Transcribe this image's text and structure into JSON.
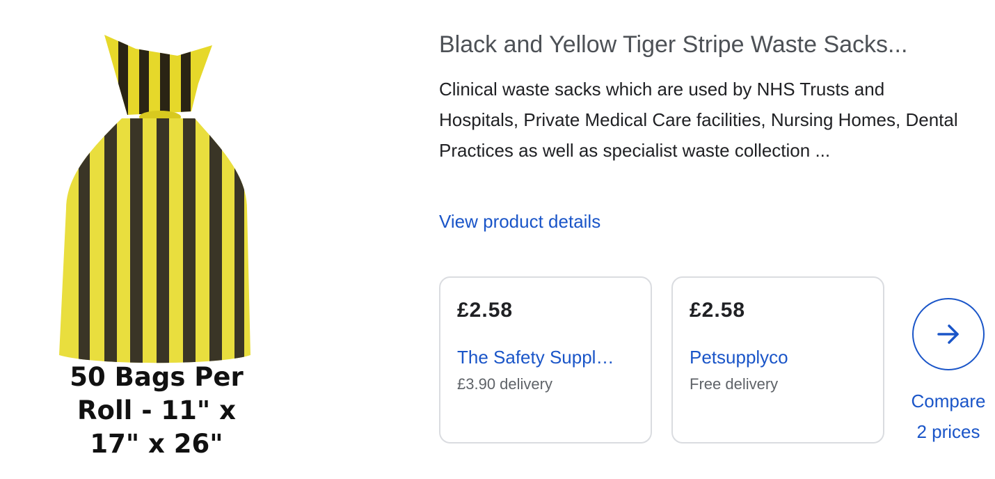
{
  "product": {
    "image_caption": "50 Bags Per\nRoll - 11\" x\n17\" x 26\"",
    "title": "Black and Yellow Tiger Stripe Waste Sacks...",
    "description": "Clinical waste sacks which are used by NHS Trusts and Hospitals, Private Medical Care facilities, Nursing Homes, Dental Practices as well as specialist waste collection ...",
    "view_details_label": "View product details"
  },
  "offers": [
    {
      "price": "£2.58",
      "seller": "The Safety Suppl…",
      "delivery": "£3.90 delivery"
    },
    {
      "price": "£2.58",
      "seller": "Petsupplyco",
      "delivery": "Free delivery"
    }
  ],
  "compare": {
    "label": "Compare\n2 prices",
    "icon": "arrow-right-icon"
  },
  "colors": {
    "link": "#1a55c8",
    "title": "#4d5156",
    "muted": "#5f6368",
    "border": "#dadce0",
    "bag_yellow": "#e6d82a",
    "bag_black": "#2a2414"
  }
}
